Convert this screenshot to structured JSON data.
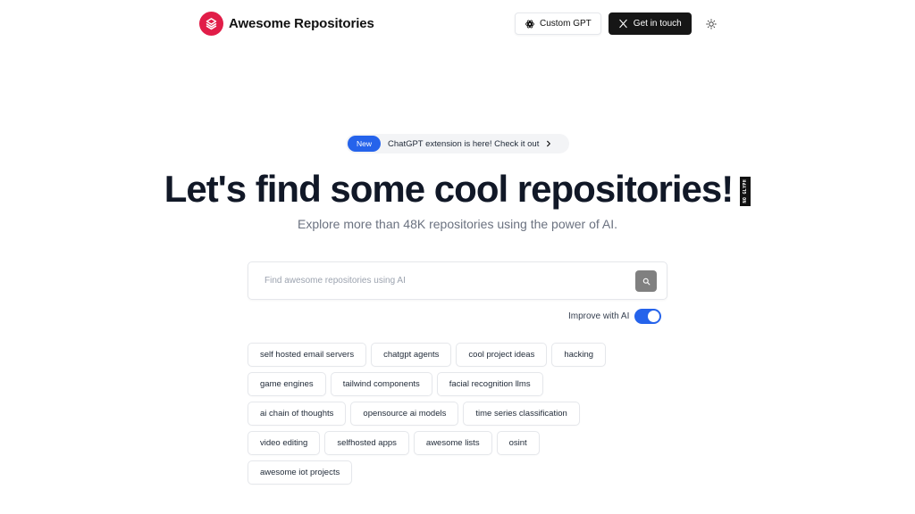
{
  "header": {
    "brand": "Awesome Repositories",
    "brand_color": "#e11d48",
    "logo_icon": "layers-icon",
    "custom_gpt_label": "Custom GPT",
    "custom_gpt_icon": "openai-icon",
    "contact_label": "Get in touch",
    "contact_icon": "x-logo-icon",
    "theme_icon": "sun-icon"
  },
  "announcement": {
    "badge": "New",
    "text": "ChatGPT extension is here! Check it out",
    "icon": "chevron-right-icon",
    "badge_color": "#2563eb"
  },
  "hero": {
    "title": "Let's find some cool repositories!",
    "emoji_fallback": "NO GLYPH",
    "subtitle": "Explore more than 48K repositories using the power of AI."
  },
  "search": {
    "placeholder": "Find awesome repositories using AI",
    "value": "",
    "button_icon": "search-icon"
  },
  "improve": {
    "label": "Improve with AI",
    "enabled": true,
    "accent": "#2563eb"
  },
  "suggestions": [
    "self hosted email servers",
    "chatgpt agents",
    "cool project ideas",
    "hacking",
    "game engines",
    "tailwind components",
    "facial recognition llms",
    "ai chain of thoughts",
    "opensource ai models",
    "time series classification",
    "video editing",
    "selfhosted apps",
    "awesome lists",
    "osint",
    "awesome iot projects"
  ]
}
